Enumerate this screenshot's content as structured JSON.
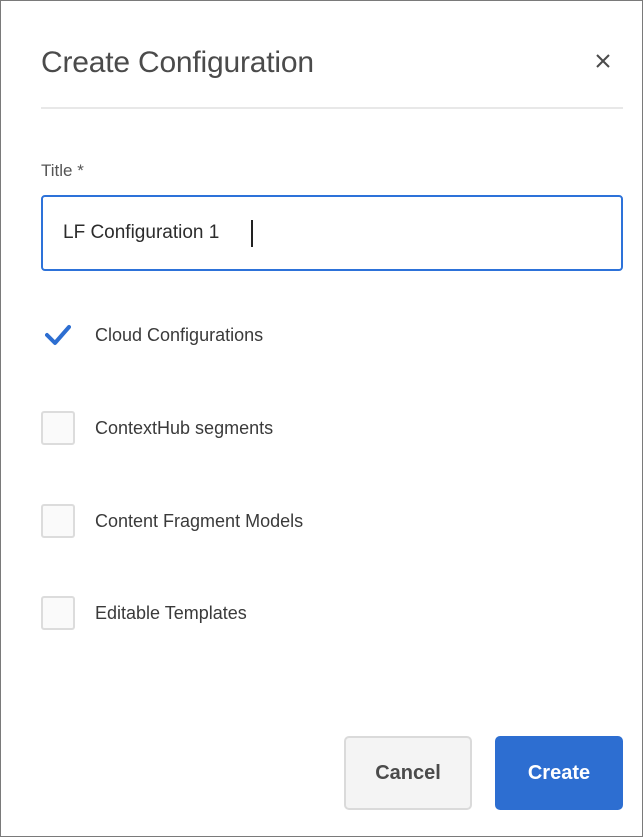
{
  "dialog": {
    "title": "Create Configuration",
    "close_icon": "close-icon"
  },
  "form": {
    "title_label": "Title *",
    "title_value": "LF Configuration 1",
    "options": [
      {
        "label": "Cloud Configurations",
        "checked": true
      },
      {
        "label": "ContextHub segments",
        "checked": false
      },
      {
        "label": "Content Fragment Models",
        "checked": false
      },
      {
        "label": "Editable Templates",
        "checked": false
      }
    ]
  },
  "actions": {
    "cancel_label": "Cancel",
    "create_label": "Create"
  },
  "colors": {
    "accent": "#2d6ed1",
    "focus_border": "#2d72d9"
  }
}
